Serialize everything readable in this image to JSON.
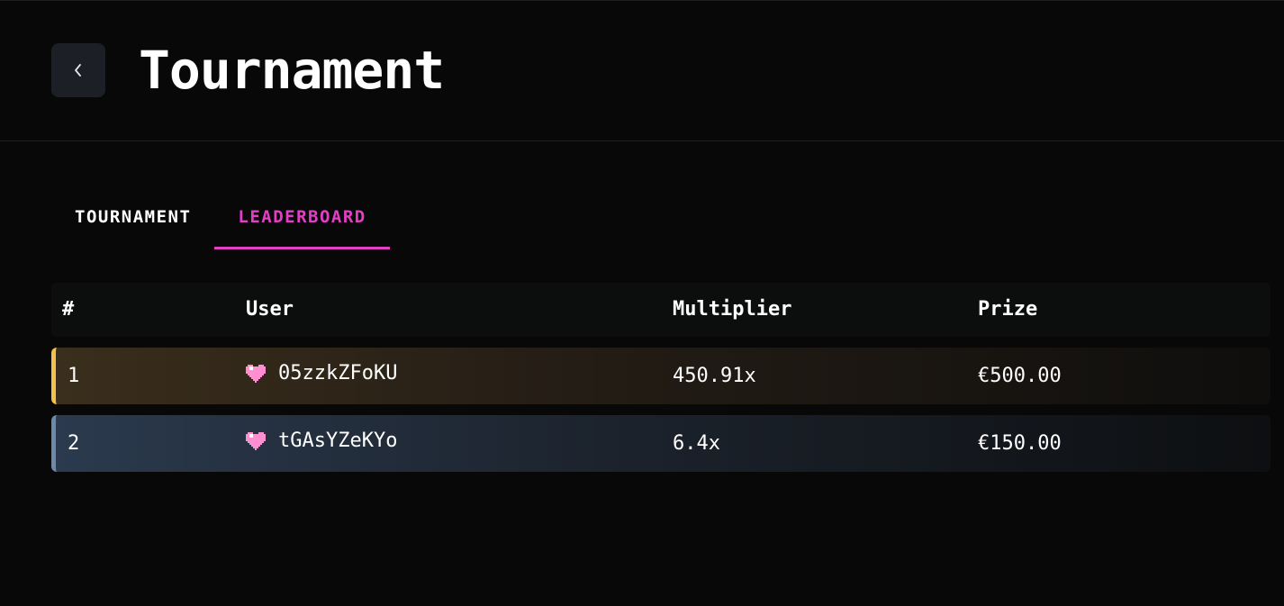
{
  "header": {
    "title": "Tournament",
    "back_icon": "chevron-left-icon"
  },
  "tabs": [
    {
      "label": "TOURNAMENT",
      "active": false
    },
    {
      "label": "LEADERBOARD",
      "active": true
    }
  ],
  "colors": {
    "accent": "#e33fc4",
    "gold": "#f2c14e",
    "silver": "#6d88a8"
  },
  "leaderboard": {
    "columns": [
      "#",
      "User",
      "Multiplier",
      "Prize"
    ],
    "rows": [
      {
        "rank": "1",
        "user": "05zzkZFoKU",
        "icon": "heart-icon",
        "multiplier": "450.91x",
        "prize": "€500.00"
      },
      {
        "rank": "2",
        "user": "tGAsYZeKYo",
        "icon": "heart-icon",
        "multiplier": "6.4x",
        "prize": "€150.00"
      }
    ]
  }
}
